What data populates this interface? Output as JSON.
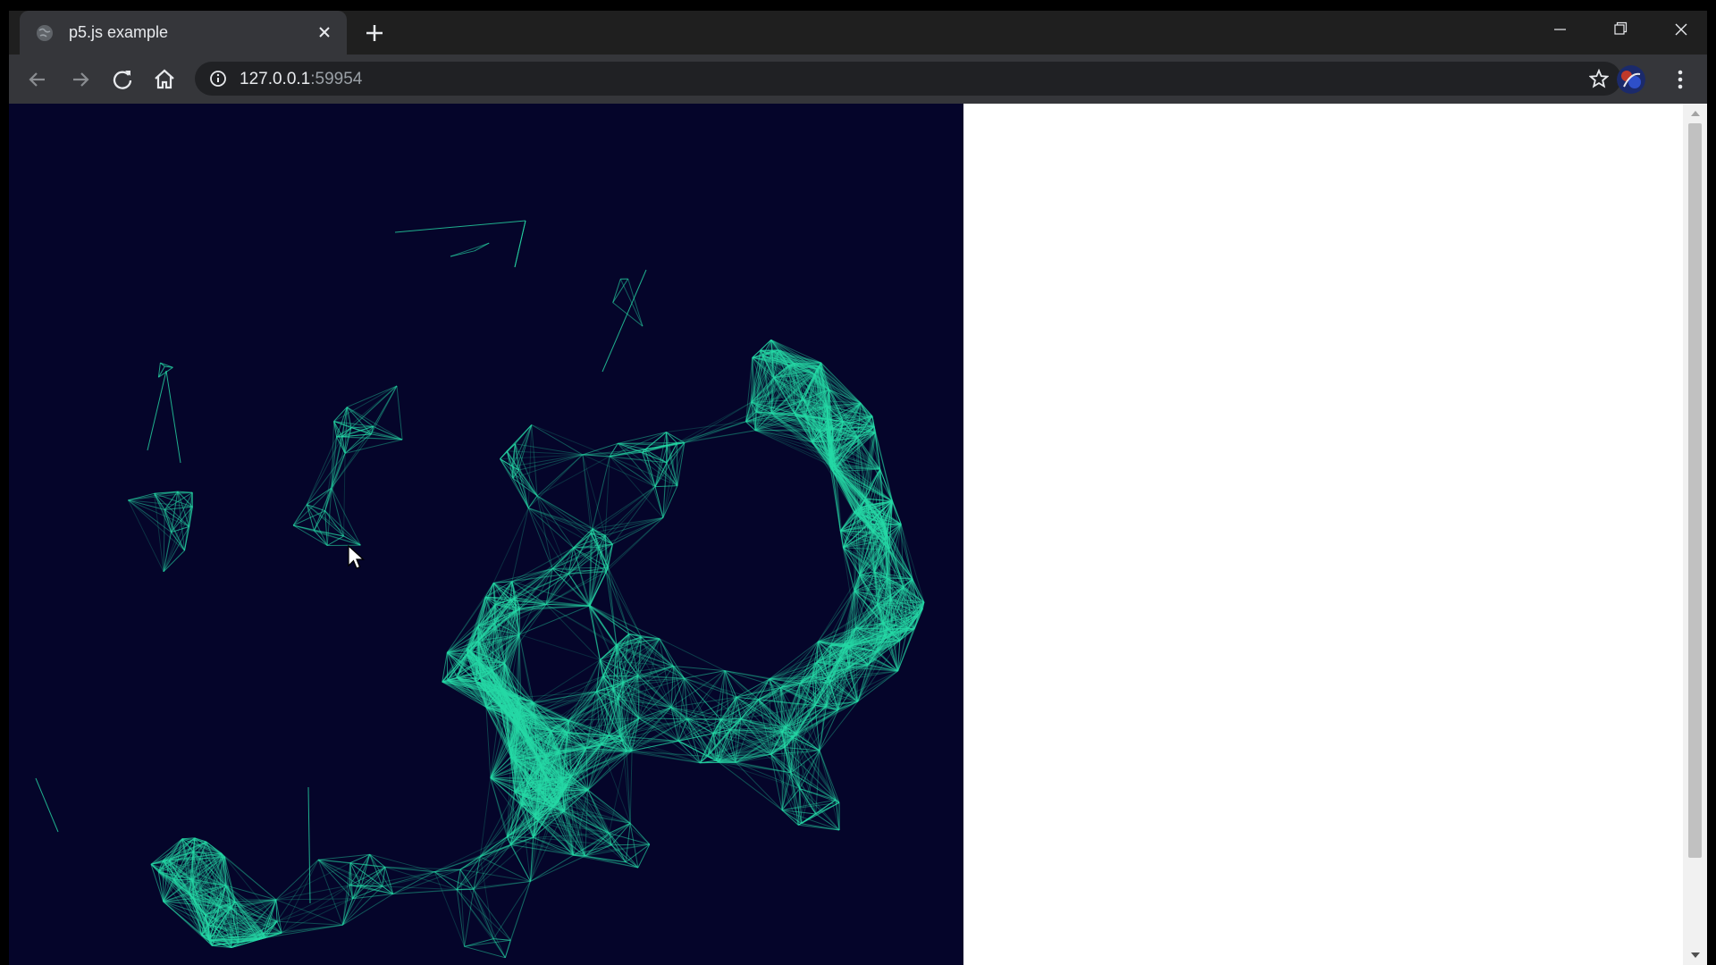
{
  "tab": {
    "title": "p5.js example"
  },
  "address": {
    "host": "127.0.0.1",
    "port": ":59954"
  },
  "colors": {
    "sketch_background": "#05052a",
    "mesh_stroke": "#26d9a6",
    "chrome_dark": "#1f1f1f",
    "chrome_toolbar": "#35363a"
  },
  "icons": {
    "tab_favicon": "globe-icon",
    "tab_close": "close-icon",
    "new_tab": "plus-icon",
    "minimize": "minimize-icon",
    "restore": "restore-icon",
    "close_window": "close-icon",
    "back": "back-arrow-icon",
    "forward": "forward-arrow-icon",
    "reload": "reload-icon",
    "home": "home-icon",
    "site_info": "info-icon",
    "bookmark": "star-icon",
    "profile": "avatar",
    "menu": "kebab-menu-icon"
  }
}
